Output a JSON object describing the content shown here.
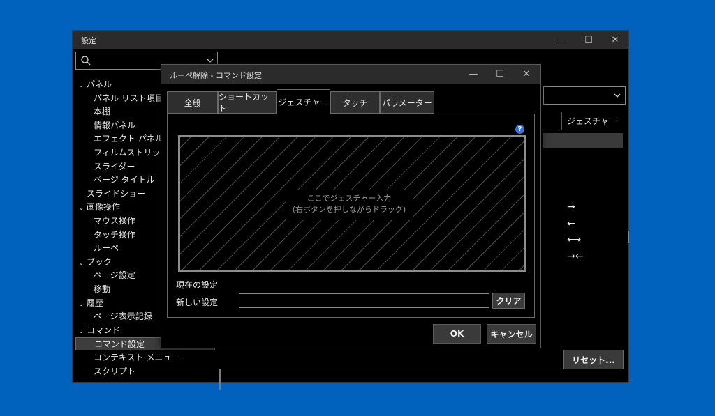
{
  "main_window": {
    "title": "設定",
    "controls": {
      "minimize": "—",
      "maximize": "☐",
      "close": "✕"
    },
    "sidebar": {
      "search_placeholder": "",
      "items": [
        {
          "label": "パネル",
          "level": 0,
          "expanded": true
        },
        {
          "label": "パネル リスト項目",
          "level": 1
        },
        {
          "label": "本棚",
          "level": 1
        },
        {
          "label": "情報パネル",
          "level": 1
        },
        {
          "label": "エフェクト パネル",
          "level": 1
        },
        {
          "label": "フィルムストリップ",
          "level": 1
        },
        {
          "label": "スライダー",
          "level": 1
        },
        {
          "label": "ページ タイトル",
          "level": 1
        },
        {
          "label": "スライドショー",
          "level": 0
        },
        {
          "label": "画像操作",
          "level": 0,
          "expanded": true
        },
        {
          "label": "マウス操作",
          "level": 1
        },
        {
          "label": "タッチ操作",
          "level": 1
        },
        {
          "label": "ルーペ",
          "level": 1
        },
        {
          "label": "ブック",
          "level": 0,
          "expanded": true
        },
        {
          "label": "ページ設定",
          "level": 1
        },
        {
          "label": "移動",
          "level": 1
        },
        {
          "label": "履歴",
          "level": 0,
          "expanded": true
        },
        {
          "label": "ページ表示記録",
          "level": 1
        },
        {
          "label": "コマンド",
          "level": 0,
          "expanded": true
        },
        {
          "label": "コマンド設定",
          "level": 1,
          "selected": true
        },
        {
          "label": "コンテキスト メニュー",
          "level": 1
        },
        {
          "label": "スクリプト",
          "level": 1
        }
      ]
    },
    "right": {
      "column_header": "ジェスチャー",
      "gesture_arrows": [
        "→",
        "←",
        "⟷",
        "→←"
      ],
      "reset_label": "リセット..."
    }
  },
  "dialog": {
    "title": "ルーペ解除 - コマンド設定",
    "controls": {
      "minimize": "—",
      "maximize": "☐",
      "close": "✕"
    },
    "tabs": [
      {
        "label": "全般",
        "active": false
      },
      {
        "label": "ショートカット",
        "active": false
      },
      {
        "label": "ジェスチャー",
        "active": true
      },
      {
        "label": "タッチ",
        "active": false
      },
      {
        "label": "パラメーター",
        "active": false
      }
    ],
    "help_icon": "?",
    "gesture_hint_line1": "ここでジェスチャー入力",
    "gesture_hint_line2": "(右ボタンを押しながらドラッグ)",
    "current_setting_label": "現在の設定",
    "current_setting_value": "",
    "new_setting_label": "新しい設定",
    "new_setting_value": "",
    "clear_label": "クリア",
    "ok_label": "OK",
    "cancel_label": "キャンセル"
  },
  "colors": {
    "desktop": "#0062bd",
    "window_bg": "#000000",
    "titlebar": "#2b2b2b",
    "button": "#3a3a3a",
    "help_blue": "#3b6fe0"
  }
}
